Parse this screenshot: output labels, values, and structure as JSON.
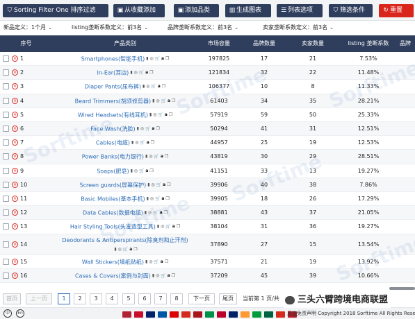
{
  "toolbar": {
    "buttons": [
      {
        "label": "Sorting Filter One 排序过滤",
        "icon": "filter-icon",
        "glyph": "⛉"
      },
      {
        "label": "从收藏添加",
        "icon": "folder-icon",
        "glyph": "▣"
      },
      {
        "label": "添加品类",
        "icon": "folder-icon",
        "glyph": "▣"
      },
      {
        "label": "生成图表",
        "icon": "chart-icon",
        "glyph": "▥"
      },
      {
        "label": "列表选项",
        "icon": "list-icon",
        "glyph": "☰"
      },
      {
        "label": "筛选条件",
        "icon": "funnel-icon",
        "glyph": "⛉"
      },
      {
        "label": "重置",
        "icon": "reset-icon",
        "glyph": "↻"
      }
    ]
  },
  "filters": [
    {
      "label": "新品定义：",
      "value": "1个月"
    },
    {
      "label": "listing垄断系数定义：",
      "value": "前3名"
    },
    {
      "label": "品牌垄断系数定义：",
      "value": "前3名"
    },
    {
      "label": "卖家垄断系数定义：",
      "value": "前3名"
    }
  ],
  "table": {
    "headers": [
      "序号",
      "产品类别",
      "市场容量",
      "品牌数量",
      "卖家数量",
      "listing 垄断系数",
      "品牌"
    ],
    "rows": [
      {
        "no": "1",
        "name": "Smartphones(智能手机)",
        "market": "197825",
        "brands": "17",
        "sellers": "21",
        "mono": "7.53%"
      },
      {
        "no": "2",
        "name": "In-Ear(耳边)",
        "market": "121834",
        "brands": "32",
        "sellers": "22",
        "mono": "11.48%"
      },
      {
        "no": "3",
        "name": "Diaper Pants(尿布裤)",
        "market": "106377",
        "brands": "10",
        "sellers": "8",
        "mono": "11.33%"
      },
      {
        "no": "4",
        "name": "Beard Trimmers(胡须修剪器)",
        "market": "61403",
        "brands": "34",
        "sellers": "35",
        "mono": "28.21%"
      },
      {
        "no": "5",
        "name": "Wired Headsets(有线耳机)",
        "market": "57919",
        "brands": "59",
        "sellers": "50",
        "mono": "25.33%"
      },
      {
        "no": "6",
        "name": "Face Wash(洗脸)",
        "market": "50294",
        "brands": "41",
        "sellers": "31",
        "mono": "12.51%"
      },
      {
        "no": "7",
        "name": "Cables(电缆)",
        "market": "44957",
        "brands": "25",
        "sellers": "19",
        "mono": "12.53%"
      },
      {
        "no": "8",
        "name": "Power Banks(电力银行)",
        "market": "43819",
        "brands": "30",
        "sellers": "29",
        "mono": "28.51%"
      },
      {
        "no": "9",
        "name": "Soaps(肥皂)",
        "market": "41151",
        "brands": "33",
        "sellers": "13",
        "mono": "19.27%"
      },
      {
        "no": "10",
        "name": "Screen guards(屏幕保护)",
        "market": "39906",
        "brands": "40",
        "sellers": "38",
        "mono": "7.86%"
      },
      {
        "no": "11",
        "name": "Basic Mobiles(基本手机)",
        "market": "39905",
        "brands": "18",
        "sellers": "26",
        "mono": "17.29%"
      },
      {
        "no": "12",
        "name": "Data Cables(数据电缆)",
        "market": "38881",
        "brands": "43",
        "sellers": "37",
        "mono": "21.05%"
      },
      {
        "no": "13",
        "name": "Hair Styling Tools(头发造型工具)",
        "market": "38104",
        "brands": "31",
        "sellers": "36",
        "mono": "19.27%"
      },
      {
        "no": "14",
        "name": "Deodorants & Antiperspirants(除臭剂和止汗剂)",
        "market": "37890",
        "brands": "27",
        "sellers": "15",
        "mono": "13.54%"
      },
      {
        "no": "15",
        "name": "Wall Stickers(墙纸贴纸)",
        "market": "37571",
        "brands": "21",
        "sellers": "19",
        "mono": "13.92%"
      },
      {
        "no": "16",
        "name": "Cases & Covers(案例与封面)",
        "market": "37209",
        "brands": "45",
        "sellers": "39",
        "mono": "10.66%"
      }
    ]
  },
  "watermark": "Sorftime",
  "pager": {
    "first": "首页",
    "prev": "上一页",
    "pages": [
      "1",
      "2",
      "3",
      "4",
      "5",
      "6",
      "7",
      "8"
    ],
    "current": "1",
    "next": "下一页",
    "last": "尾页",
    "info": "当前第 1 页/共"
  },
  "footer": {
    "lang_zh": "中",
    "lang_en": "En",
    "disclaimer": "反盗免责声明",
    "copyright": "Copyright 2018 Sorftime All Rights Reserved"
  },
  "overlay": {
    "text": "三头六臂跨境电商联盟"
  },
  "colors": {
    "nav": "#2f3e5d",
    "reset": "#d9251c",
    "link": "#2a6bb6",
    "flags": [
      "#b22234",
      "#c8102e",
      "#012169",
      "#0055a4",
      "#dd0000",
      "#d52b1e",
      "#aa151b",
      "#009246",
      "#bc002d",
      "#012169",
      "#ff9933",
      "#009c3b",
      "#006341",
      "#d52b1e",
      "#ae1c28"
    ]
  }
}
